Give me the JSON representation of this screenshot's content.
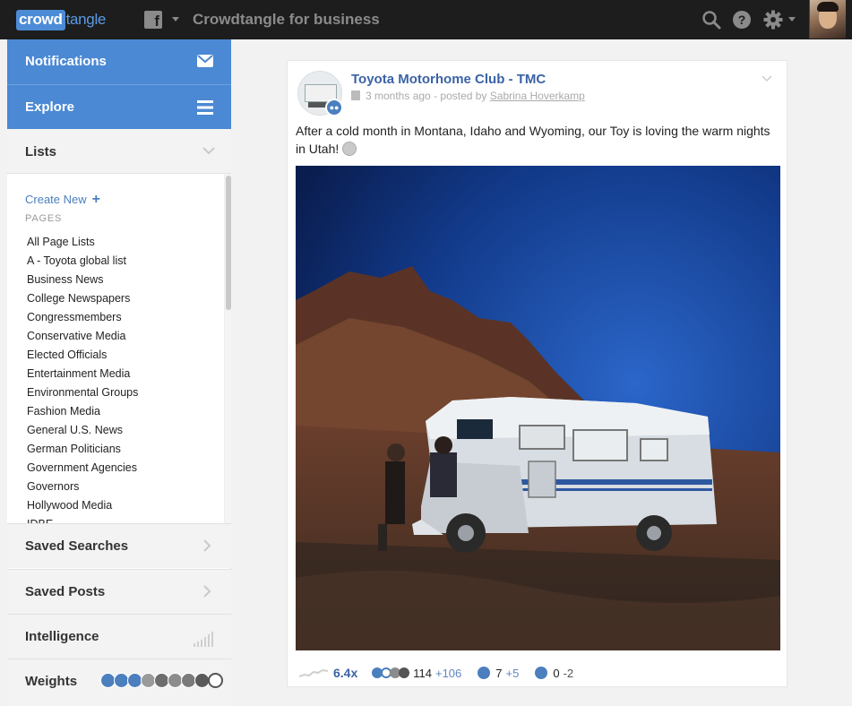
{
  "header": {
    "logo_part1": "crowd",
    "logo_part2": "tangle",
    "app_title": "Crowdtangle for business",
    "fb_glyph": "f"
  },
  "sidebar": {
    "notifications_label": "Notifications",
    "explore_label": "Explore",
    "lists_label": "Lists",
    "create_new_label": "Create New",
    "pages_label": "PAGES",
    "page_lists": [
      "All Page Lists",
      "A - Toyota global list",
      "Business News",
      "College Newspapers",
      "Congressmembers",
      "Conservative Media",
      "Elected Officials",
      "Entertainment Media",
      "Environmental Groups",
      "Fashion Media",
      "General U.S. News",
      "German Politicians",
      "Government Agencies",
      "Governors",
      "Hollywood Media",
      "IDBE"
    ],
    "saved_searches_label": "Saved Searches",
    "saved_posts_label": "Saved Posts",
    "intelligence_label": "Intelligence",
    "weights_label": "Weights"
  },
  "post": {
    "page_name": "Toyota Motorhome Club - TMC",
    "age": "3 months ago",
    "posted_by_prefix": "- posted by",
    "poster": "Sabrina Hoverkamp",
    "text": "After a cold month in Montana, Idaho and Wyoming, our Toy is loving the warm nights in Utah!",
    "overperform": "6.4x",
    "reactions_count": "114",
    "reactions_delta": "+106",
    "comments_count": "7",
    "comments_delta": "+5",
    "shares_count": "0",
    "shares_delta": "-2"
  },
  "colors": {
    "topbar_bg": "#1d1d1d",
    "nav_blue": "#4b89d4",
    "link_blue": "#3b63a6"
  },
  "icons": {
    "topbar": [
      "search-icon",
      "help-icon",
      "gear-icon"
    ],
    "sidebar": [
      "envelope-icon",
      "menu-icon",
      "chevron-down-icon",
      "chevron-right-icon",
      "bars-chart-icon"
    ],
    "stats": [
      "sparkline-icon",
      "reactions-icon",
      "comment-icon",
      "share-icon"
    ]
  }
}
